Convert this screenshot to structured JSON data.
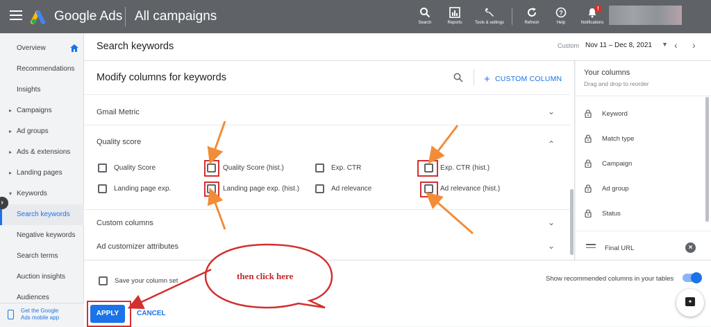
{
  "header": {
    "brand": "Google Ads",
    "page_title": "All campaigns",
    "tools": [
      {
        "label": "Search",
        "icon": "search-icon"
      },
      {
        "label": "Reports",
        "icon": "reports-icon"
      },
      {
        "label": "Tools & settings",
        "icon": "wrench-icon"
      },
      {
        "label": "Refresh",
        "icon": "refresh-icon"
      },
      {
        "label": "Help",
        "icon": "help-icon"
      },
      {
        "label": "Notifications",
        "icon": "bell-icon"
      }
    ],
    "notification_badge": "!"
  },
  "sidebar": {
    "items": [
      {
        "label": "Overview"
      },
      {
        "label": "Recommendations"
      },
      {
        "label": "Insights"
      },
      {
        "label": "Campaigns"
      },
      {
        "label": "Ad groups"
      },
      {
        "label": "Ads & extensions"
      },
      {
        "label": "Landing pages"
      },
      {
        "label": "Keywords"
      },
      {
        "label": "Search keywords"
      },
      {
        "label": "Negative keywords"
      },
      {
        "label": "Search terms"
      },
      {
        "label": "Auction insights"
      },
      {
        "label": "Audiences"
      }
    ],
    "mobile_app_line1": "Get the Google",
    "mobile_app_line2": "Ads mobile app"
  },
  "main_header": {
    "title": "Search keywords",
    "date_label": "Custom",
    "date_range": "Nov 11 – Dec 8, 2021"
  },
  "panel": {
    "title": "Modify columns for keywords",
    "custom_column": "CUSTOM COLUMN",
    "sections": {
      "gmail": "Gmail Metric",
      "quality": "Quality score",
      "custom": "Custom columns",
      "ad_customizer": "Ad customizer attributes"
    },
    "quality_checkboxes": [
      "Quality Score",
      "Quality Score (hist.)",
      "Exp. CTR",
      "Exp. CTR (hist.)",
      "Landing page exp.",
      "Landing page exp. (hist.)",
      "Ad relevance",
      "Ad relevance (hist.)"
    ]
  },
  "footer": {
    "save_column_set": "Save your column set",
    "show_recommended": "Show recommended columns in your tables",
    "apply": "APPLY",
    "cancel": "CANCEL"
  },
  "your_columns": {
    "title": "Your columns",
    "subtitle": "Drag and drop to reorder",
    "locked": [
      "Keyword",
      "Match type",
      "Campaign",
      "Ad group",
      "Status"
    ],
    "final": "Final URL"
  },
  "annotation": {
    "callout": "then click here"
  },
  "colors": {
    "topbar": "#5f6368",
    "accent": "#1a73e8",
    "annotation_red": "#d32f2f",
    "annotation_orange": "#f28c38"
  }
}
